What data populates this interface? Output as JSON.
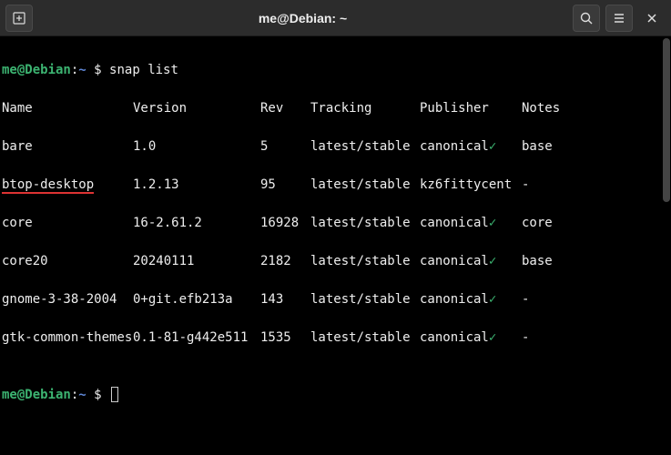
{
  "titlebar": {
    "title": "me@Debian: ~"
  },
  "prompt": {
    "user_host": "me@Debian",
    "separator": ":",
    "path": "~",
    "symbol": "$"
  },
  "command": "snap list",
  "headers": {
    "name": "Name",
    "version": "Version",
    "rev": "Rev",
    "tracking": "Tracking",
    "publisher": "Publisher",
    "notes": "Notes"
  },
  "rows": [
    {
      "name": "bare",
      "version": "1.0",
      "rev": "5",
      "tracking": "latest/stable",
      "publisher": "canonical",
      "verified": true,
      "notes": "base",
      "highlight": false
    },
    {
      "name": "btop-desktop",
      "version": "1.2.13",
      "rev": "95",
      "tracking": "latest/stable",
      "publisher": "kz6fittycent",
      "verified": false,
      "notes": "-",
      "highlight": true
    },
    {
      "name": "core",
      "version": "16-2.61.2",
      "rev": "16928",
      "tracking": "latest/stable",
      "publisher": "canonical",
      "verified": true,
      "notes": "core",
      "highlight": false
    },
    {
      "name": "core20",
      "version": "20240111",
      "rev": "2182",
      "tracking": "latest/stable",
      "publisher": "canonical",
      "verified": true,
      "notes": "base",
      "highlight": false
    },
    {
      "name": "gnome-3-38-2004",
      "version": "0+git.efb213a",
      "rev": "143",
      "tracking": "latest/stable",
      "publisher": "canonical",
      "verified": true,
      "notes": "-",
      "highlight": false
    },
    {
      "name": "gtk-common-themes",
      "version": "0.1-81-g442e511",
      "rev": "1535",
      "tracking": "latest/stable",
      "publisher": "canonical",
      "verified": true,
      "notes": "-",
      "highlight": false
    }
  ],
  "checkmark": "✓"
}
